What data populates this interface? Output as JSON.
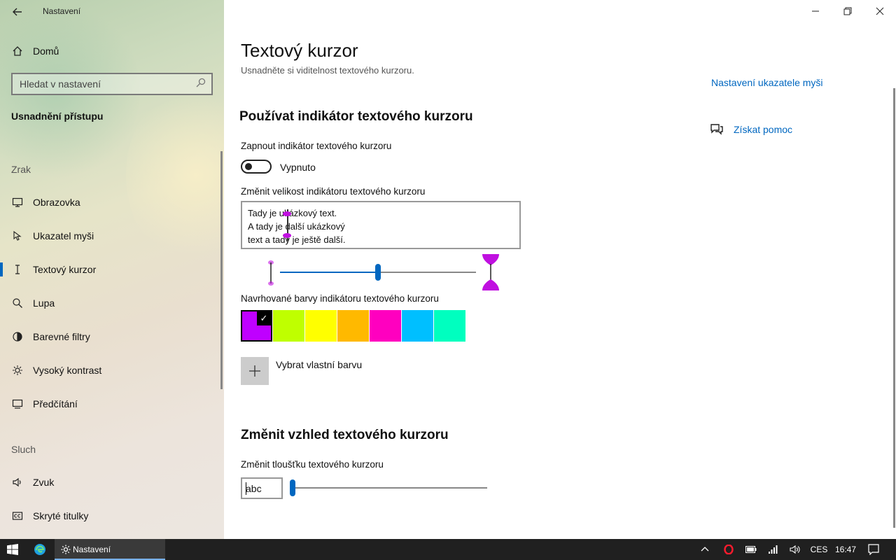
{
  "app": {
    "title": "Nastavení"
  },
  "sidebar": {
    "home": "Domů",
    "search_placeholder": "Hledat v nastavení",
    "section": "Usnadnění přístupu",
    "groups": [
      {
        "label": "Zrak",
        "items": [
          {
            "label": "Obrazovka",
            "icon": "monitor-icon"
          },
          {
            "label": "Ukazatel myši",
            "icon": "mouse-pointer-icon"
          },
          {
            "label": "Textový kurzor",
            "icon": "text-cursor-icon",
            "active": true
          },
          {
            "label": "Lupa",
            "icon": "magnifier-icon"
          },
          {
            "label": "Barevné filtry",
            "icon": "color-filter-icon"
          },
          {
            "label": "Vysoký kontrast",
            "icon": "brightness-icon"
          },
          {
            "label": "Předčítání",
            "icon": "narrator-icon"
          }
        ]
      },
      {
        "label": "Sluch",
        "items": [
          {
            "label": "Zvuk",
            "icon": "speaker-icon"
          },
          {
            "label": "Skryté titulky",
            "icon": "captions-icon"
          }
        ]
      }
    ]
  },
  "main": {
    "title": "Textový kurzor",
    "subtitle": "Usnadněte si viditelnost textového kurzoru.",
    "section1": {
      "heading": "Používat indikátor textového kurzoru",
      "toggle_label": "Zapnout indikátor textového kurzoru",
      "toggle_state": "Vypnuto",
      "toggle_on": false,
      "size_label": "Změnit velikost indikátoru textového kurzoru",
      "preview_lines": [
        "Tady je ukázkový text.",
        "A tady je další ukázkový",
        "text a tady je ještě další."
      ],
      "size_value": 0.5,
      "colors_label": "Navrhované barvy indikátoru textového kurzoru",
      "colors": [
        "#bf00ff",
        "#bfff00",
        "#ffff00",
        "#ffb900",
        "#ff00bf",
        "#00bfff",
        "#00ffbf"
      ],
      "selected_color": 0,
      "custom_color": "Vybrat vlastní barvu"
    },
    "section2": {
      "heading": "Změnit vzhled textového kurzoru",
      "thickness_label": "Změnit tloušťku textového kurzoru",
      "sample": "abc",
      "thickness_value": 0.0
    }
  },
  "related": {
    "mouse_link": "Nastavení ukazatele myši",
    "help_link": "Získat pomoc"
  },
  "taskbar": {
    "app": "Nastavení",
    "lang": "CES",
    "time": "16:47"
  },
  "colors": {
    "accent": "#0067c0"
  }
}
